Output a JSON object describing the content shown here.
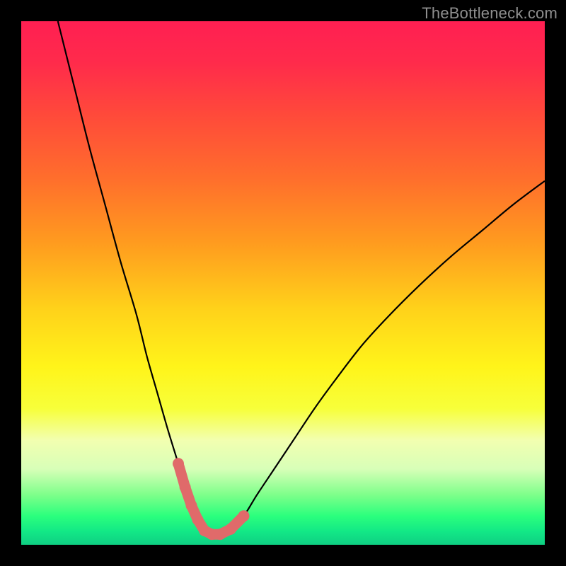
{
  "watermark": "TheBottleneck.com",
  "gradient": {
    "stops": [
      {
        "offset": 0.0,
        "color": "#ff1f52"
      },
      {
        "offset": 0.08,
        "color": "#ff2b4b"
      },
      {
        "offset": 0.18,
        "color": "#ff4a3a"
      },
      {
        "offset": 0.3,
        "color": "#ff6e2c"
      },
      {
        "offset": 0.42,
        "color": "#ff9a1f"
      },
      {
        "offset": 0.55,
        "color": "#ffd21a"
      },
      {
        "offset": 0.66,
        "color": "#fff41a"
      },
      {
        "offset": 0.74,
        "color": "#f7ff3a"
      },
      {
        "offset": 0.8,
        "color": "#f2ffb0"
      },
      {
        "offset": 0.855,
        "color": "#d8ffb8"
      },
      {
        "offset": 0.905,
        "color": "#7dff8a"
      },
      {
        "offset": 0.945,
        "color": "#2bff7d"
      },
      {
        "offset": 0.975,
        "color": "#12e886"
      },
      {
        "offset": 1.0,
        "color": "#0fcf83"
      }
    ]
  },
  "chart_data": {
    "type": "line",
    "title": "",
    "xlabel": "",
    "ylabel": "",
    "xlim": [
      0,
      100
    ],
    "ylim": [
      0,
      100
    ],
    "series": [
      {
        "name": "bottleneck-curve",
        "x": [
          7,
          10,
          13,
          16,
          19,
          22,
          24,
          26,
          28,
          30,
          31.3,
          32.5,
          33.7,
          35,
          36.4,
          38,
          40,
          42.5,
          45,
          48,
          52,
          56,
          60,
          65,
          70,
          76,
          82,
          88,
          94,
          100
        ],
        "y": [
          100,
          88,
          76,
          65,
          54,
          44,
          36,
          29,
          22,
          15.5,
          11,
          7.5,
          4.8,
          2.7,
          2.0,
          2.0,
          3.0,
          5.5,
          9.5,
          14,
          20,
          26,
          31.5,
          38,
          43.5,
          49.5,
          55,
          60,
          65,
          69.5
        ]
      }
    ],
    "marker_band": {
      "name": "highlight-dots",
      "color": "#e06a6a",
      "x": [
        30,
        31.3,
        32.5,
        33.7,
        35,
        36.4,
        38,
        40,
        42.5
      ],
      "y": [
        15.5,
        11,
        7.5,
        4.8,
        2.7,
        2.0,
        2.0,
        3.0,
        5.5
      ]
    }
  }
}
